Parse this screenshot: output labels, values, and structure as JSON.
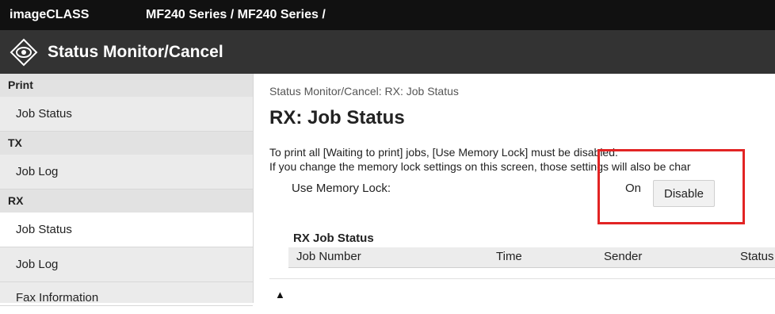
{
  "header": {
    "brand": "imageCLASS",
    "series": "MF240 Series / MF240 Series /"
  },
  "titlebar": {
    "title": "Status Monitor/Cancel",
    "icon": "eye-diamond-icon"
  },
  "sidebar": {
    "sections": [
      {
        "title": "Print",
        "items": [
          "Job Status"
        ]
      },
      {
        "title": "TX",
        "items": [
          "Job Log"
        ]
      },
      {
        "title": "RX",
        "items": [
          "Job Status",
          "Job Log"
        ]
      }
    ],
    "active_item": "RX / Job Status",
    "partial_item": "Fax Information"
  },
  "main": {
    "breadcrumb": "Status Monitor/Cancel: RX: Job Status",
    "title": "RX: Job Status",
    "message_line1": "To print all [Waiting to print] jobs, [Use Memory Lock] must be disabled.",
    "message_line2": "If you change the memory lock settings on this screen, those settings will also be char",
    "memory_lock_label": "Use Memory Lock:",
    "memory_lock_value": "On",
    "disable_button": "Disable",
    "table": {
      "title": "RX Job Status",
      "columns": [
        "Job Number",
        "Time",
        "Sender",
        "Status"
      ]
    },
    "top_icon": "▲"
  },
  "colors": {
    "topbar": "#111111",
    "titlebar": "#333333",
    "sidebar": "#ebebeb",
    "highlight": "#e22424"
  }
}
